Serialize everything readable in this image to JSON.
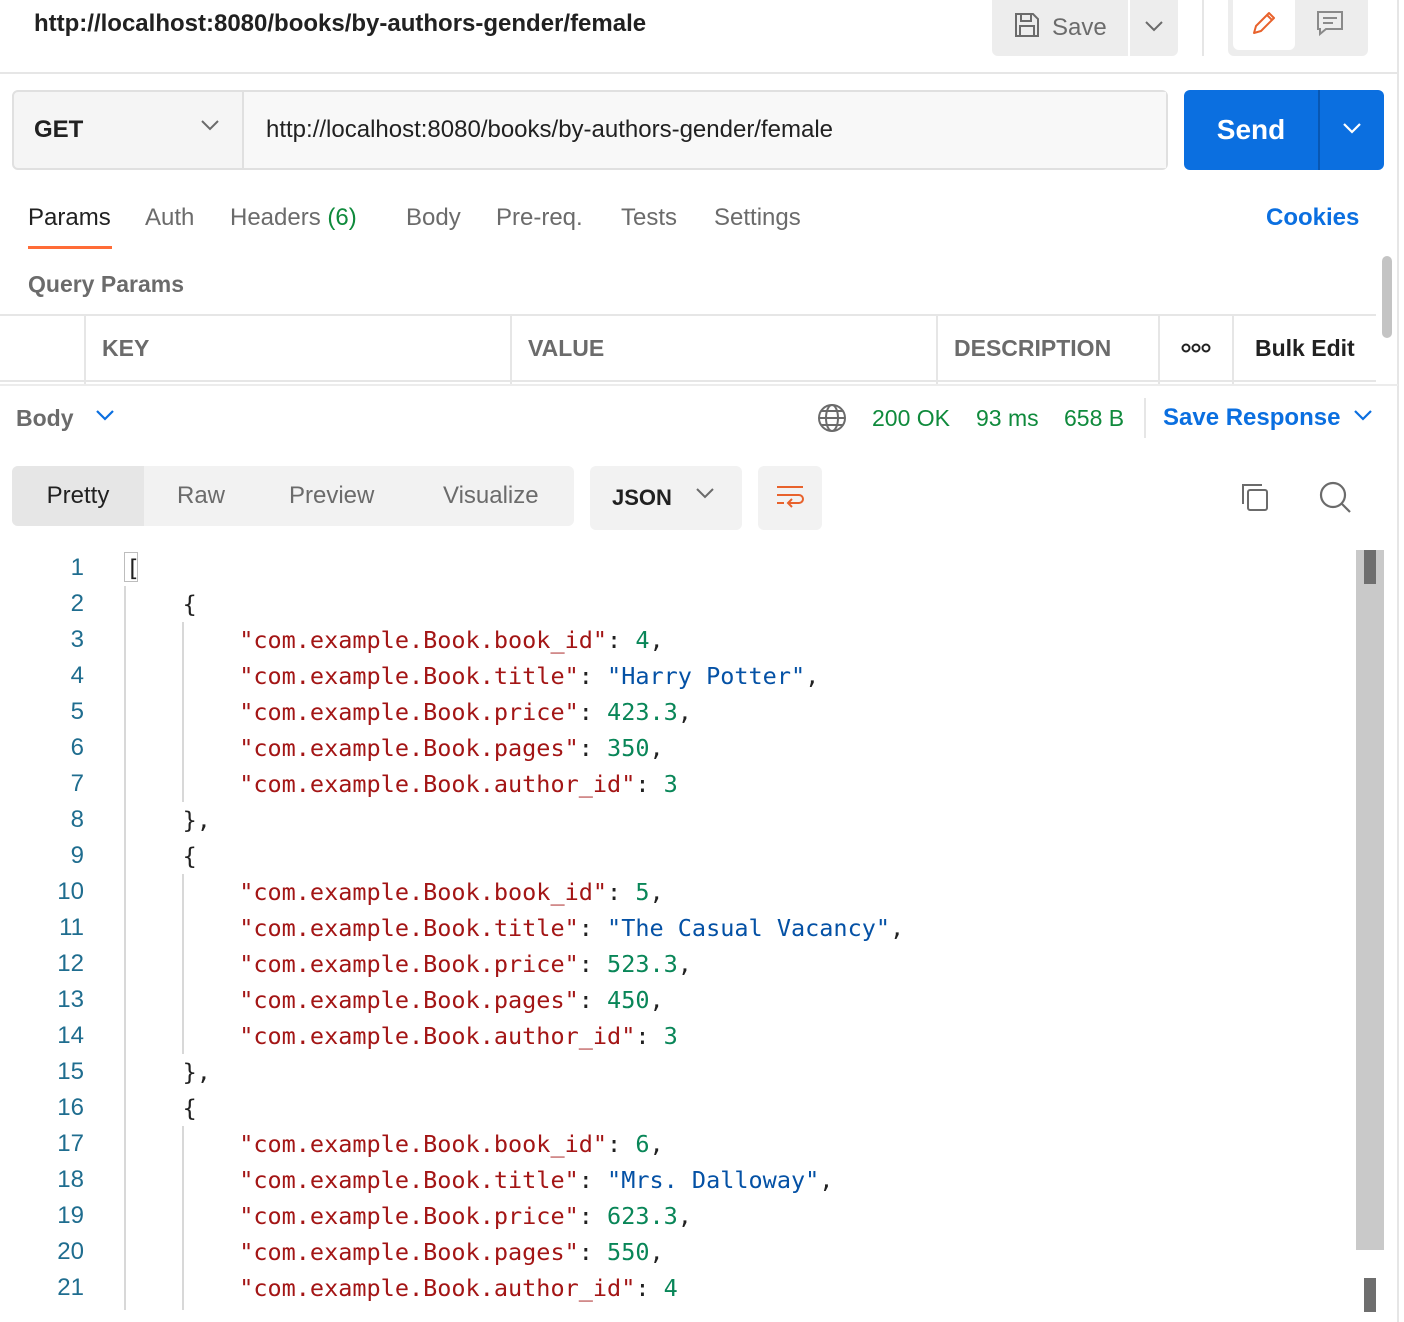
{
  "header": {
    "title_url": "http://localhost:8080/books/by-authors-gender/female",
    "save_label": "Save"
  },
  "request": {
    "method": "GET",
    "url": "http://localhost:8080/books/by-authors-gender/female",
    "send_label": "Send"
  },
  "tabs": {
    "params": "Params",
    "auth": "Auth",
    "headers": "Headers",
    "headers_count": "(6)",
    "body": "Body",
    "prereq": "Pre-req.",
    "tests": "Tests",
    "settings": "Settings",
    "cookies": "Cookies"
  },
  "query_params": {
    "title": "Query Params",
    "columns": [
      "KEY",
      "VALUE",
      "DESCRIPTION"
    ],
    "bulk_edit": "Bulk Edit"
  },
  "response": {
    "body_label": "Body",
    "status": "200 OK",
    "time": "93 ms",
    "size": "658 B",
    "save_response": "Save Response",
    "views": [
      "Pretty",
      "Raw",
      "Preview",
      "Visualize"
    ],
    "format": "JSON"
  },
  "colors": {
    "accent_blue": "#0b6fe0",
    "active_tab_underline": "#ff6c37",
    "status_green": "#0f8a3c"
  },
  "code_lines": [
    {
      "n": "1",
      "t": "["
    },
    {
      "n": "2",
      "t": "    {"
    },
    {
      "n": "3",
      "t": "        \"com.example.Book.book_id\": 4,"
    },
    {
      "n": "4",
      "t": "        \"com.example.Book.title\": \"Harry Potter\","
    },
    {
      "n": "5",
      "t": "        \"com.example.Book.price\": 423.3,"
    },
    {
      "n": "6",
      "t": "        \"com.example.Book.pages\": 350,"
    },
    {
      "n": "7",
      "t": "        \"com.example.Book.author_id\": 3"
    },
    {
      "n": "8",
      "t": "    },"
    },
    {
      "n": "9",
      "t": "    {"
    },
    {
      "n": "10",
      "t": "        \"com.example.Book.book_id\": 5,"
    },
    {
      "n": "11",
      "t": "        \"com.example.Book.title\": \"The Casual Vacancy\","
    },
    {
      "n": "12",
      "t": "        \"com.example.Book.price\": 523.3,"
    },
    {
      "n": "13",
      "t": "        \"com.example.Book.pages\": 450,"
    },
    {
      "n": "14",
      "t": "        \"com.example.Book.author_id\": 3"
    },
    {
      "n": "15",
      "t": "    },"
    },
    {
      "n": "16",
      "t": "    {"
    },
    {
      "n": "17",
      "t": "        \"com.example.Book.book_id\": 6,"
    },
    {
      "n": "18",
      "t": "        \"com.example.Book.title\": \"Mrs. Dalloway\","
    },
    {
      "n": "19",
      "t": "        \"com.example.Book.price\": 623.3,"
    },
    {
      "n": "20",
      "t": "        \"com.example.Book.pages\": 550,"
    },
    {
      "n": "21",
      "t": "        \"com.example.Book.author_id\": 4"
    }
  ]
}
